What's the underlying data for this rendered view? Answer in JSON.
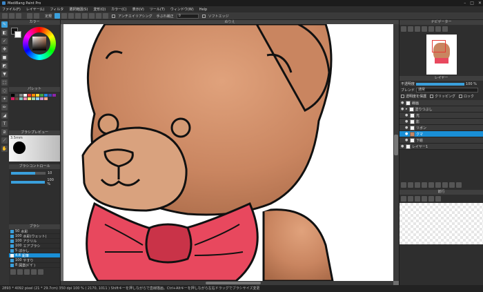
{
  "app": {
    "title": "MediBang Paint Pro",
    "win_min": "–",
    "win_max": "□",
    "win_close": "✕"
  },
  "menu": [
    "ファイル(F)",
    "レイヤー(L)",
    "フィルタ",
    "選択範囲(S)",
    "変形(Q)",
    "カラー(C)",
    "表示(V)",
    "ツール(T)",
    "ウィンドウ(W)",
    "Help"
  ],
  "toolbar": {
    "mode_label": "定規",
    "antialias_label": "アンチエイリアシング",
    "correction_label": "手ぶれ補正",
    "correction_value": "0",
    "snap_label": "ソフトエッジ"
  },
  "panels": {
    "color": "カラー",
    "palette": "パレット",
    "brush_preview": "ブラシプレビュー",
    "brush_control": "ブラシコントロール",
    "brush": "ブラシ",
    "navigator": "ナビゲーター",
    "layer": "レイヤー",
    "canvas_tab": "ぬりえ",
    "window": "前行"
  },
  "brush_preview": {
    "size": "3.5mm"
  },
  "brush_control": {
    "size": "10",
    "opacity": "100 %"
  },
  "brushes": [
    {
      "num": "50",
      "name": "水彩"
    },
    {
      "num": "100",
      "name": "水彩(ウェット)"
    },
    {
      "num": "100",
      "name": "アクリル"
    },
    {
      "num": "100",
      "name": "エアブラシ"
    },
    {
      "num": "5",
      "name": "ぼかし"
    },
    {
      "num": "4.8",
      "name": "鉛筆",
      "selected": true
    },
    {
      "num": "100",
      "name": "やすり"
    },
    {
      "num": "8",
      "name": "図案(ｷﾞｻﾞ)"
    }
  ],
  "layer_panel": {
    "opacity_label": "不透明度",
    "opacity_value": "100 %",
    "blend_label": "ブレンド",
    "blend_value": "通常",
    "protect_label": "透明度を保護",
    "clip_label": "クリッピング",
    "lock_label": "ロック"
  },
  "layers": [
    {
      "name": "線画"
    },
    {
      "name": "塗りつぶし"
    },
    {
      "name": "光"
    },
    {
      "name": "影"
    },
    {
      "name": "リボン"
    },
    {
      "name": "クマ",
      "selected": true
    },
    {
      "name": "下絵"
    },
    {
      "name": "レイヤー1"
    }
  ],
  "status": {
    "text": "2893 * 4092 pixel (21 * 29.7cm) 350 dpi 100 % ( 2170, 1011 ) Shiftキーを押しながらで直線描画。Ctrl+Altキーを押しながら左右ドラッグでブラシサイズ変更"
  },
  "colors": {
    "accent": "#3aa0dc",
    "bear": "#c98560",
    "bow": "#e8485e",
    "outline": "#111111"
  },
  "palette_colors": [
    "#000000",
    "#444444",
    "#888888",
    "#ffffff",
    "#e53935",
    "#fb8c00",
    "#fdd835",
    "#43a047",
    "#1e88e5",
    "#3949ab",
    "#8e24aa",
    "#d81b60",
    "#6d4c41",
    "#80cbc4",
    "#f48fb1",
    "#fff176",
    "#a5d6a7",
    "#90caf9",
    "#ce93d8",
    "#ffab91"
  ],
  "tools": [
    "pen-icon",
    "eraser-icon",
    "dot-icon",
    "move-icon",
    "fill-icon",
    "gradient-icon",
    "select-icon",
    "lasso-icon",
    "magic-wand-icon",
    "text-icon",
    "eyedropper-icon",
    "hand-icon",
    "zoom-icon"
  ]
}
